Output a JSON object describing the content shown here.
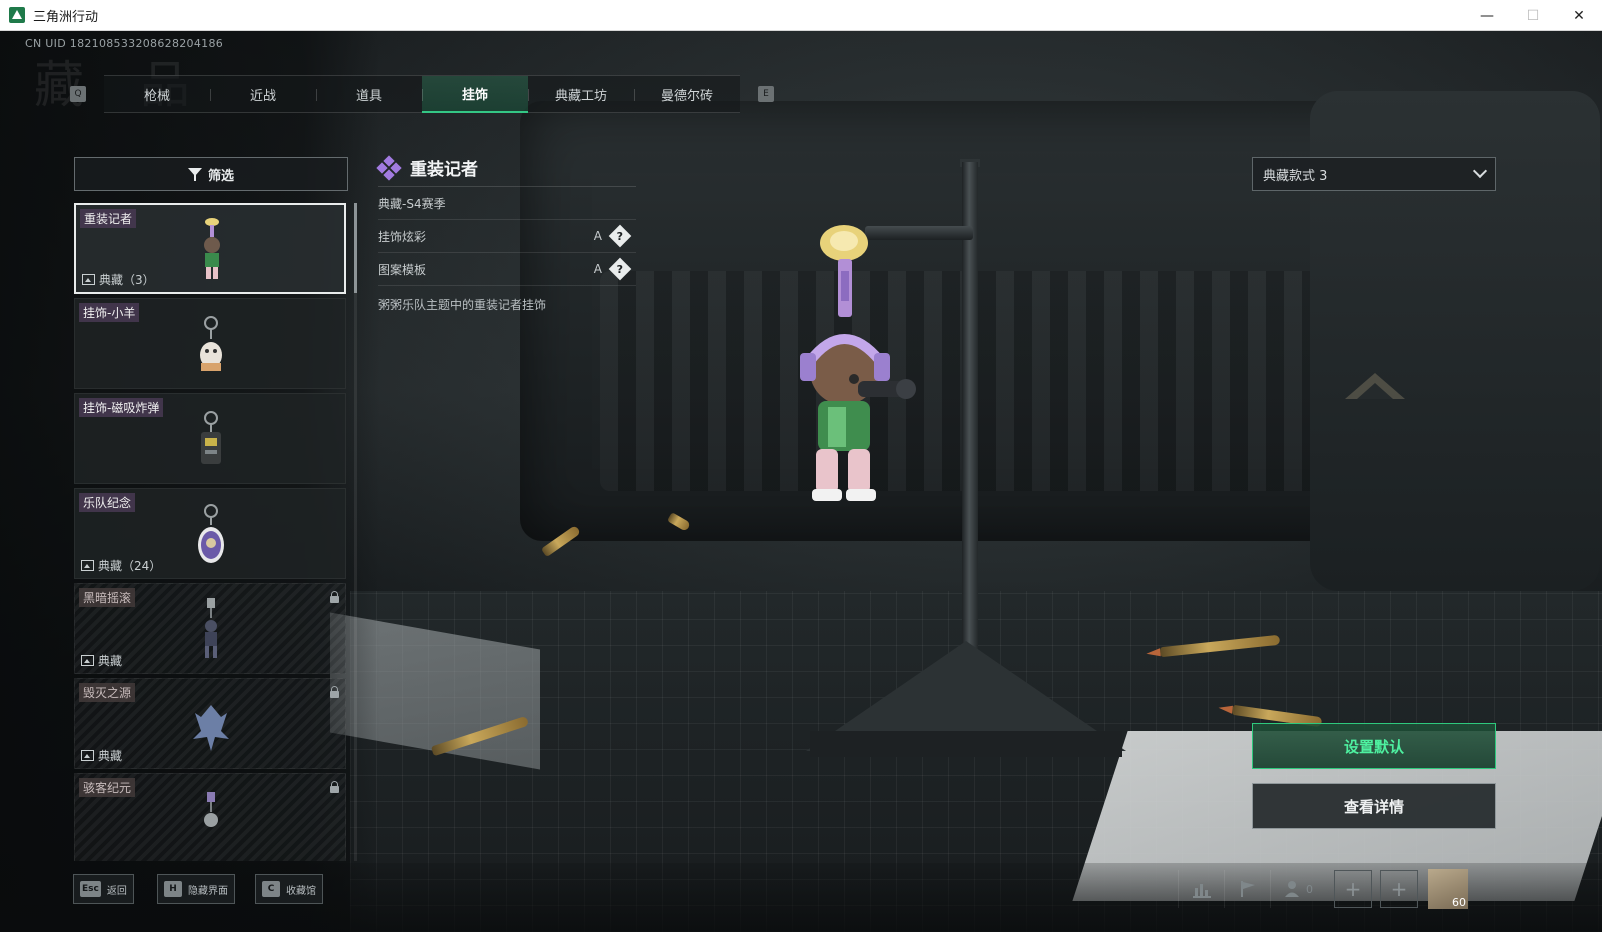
{
  "window": {
    "title": "三角洲行动",
    "controls": {
      "minimize": "—",
      "maximize": "☐",
      "close": "✕"
    }
  },
  "header": {
    "uid": "CN UID 18210853320862820418​6",
    "watermark": "藏 品"
  },
  "tabs": {
    "prev_key": "Q",
    "next_key": "E",
    "items": [
      {
        "label": "枪械",
        "active": false
      },
      {
        "label": "近战",
        "active": false
      },
      {
        "label": "道具",
        "active": false
      },
      {
        "label": "挂饰",
        "active": true
      },
      {
        "label": "典藏工坊",
        "active": false
      },
      {
        "label": "曼德尔砖",
        "active": false
      }
    ]
  },
  "filter": {
    "label": "筛选"
  },
  "items": [
    {
      "name": "重装记者",
      "collection": "典藏（3）",
      "selected": true,
      "locked": false
    },
    {
      "name": "挂饰-小羊",
      "collection": "",
      "selected": false,
      "locked": false
    },
    {
      "name": "挂饰-磁吸炸弹",
      "collection": "",
      "selected": false,
      "locked": false
    },
    {
      "name": "乐队纪念",
      "collection": "典藏（24）",
      "selected": false,
      "locked": false
    },
    {
      "name": "黑暗摇滚",
      "collection": "典藏",
      "selected": false,
      "locked": true
    },
    {
      "name": "毁灭之源",
      "collection": "典藏",
      "selected": false,
      "locked": true
    },
    {
      "name": "骇客纪元",
      "collection": "",
      "selected": false,
      "locked": true
    }
  ],
  "detail": {
    "title": "重装记者",
    "season": "典藏-S4赛季",
    "rows": [
      {
        "label": "挂饰炫彩",
        "grade": "A",
        "help": "?"
      },
      {
        "label": "图案模板",
        "grade": "A",
        "help": "?"
      }
    ],
    "description": "粥粥乐队主题中的重装记者挂饰"
  },
  "variant": {
    "selected": "典藏款式 3"
  },
  "actions": {
    "set_default": "设置默认",
    "view_details": "查看详情"
  },
  "bottom": {
    "hints": [
      {
        "key": "Esc",
        "label": "返回"
      },
      {
        "key": "H",
        "label": "隐藏界面"
      },
      {
        "key": "C",
        "label": "收藏馆"
      }
    ],
    "friends_count": "0",
    "player_level": "60"
  },
  "colors": {
    "accent_green": "#2ec97d",
    "rarity_purple": "#a27be0"
  }
}
